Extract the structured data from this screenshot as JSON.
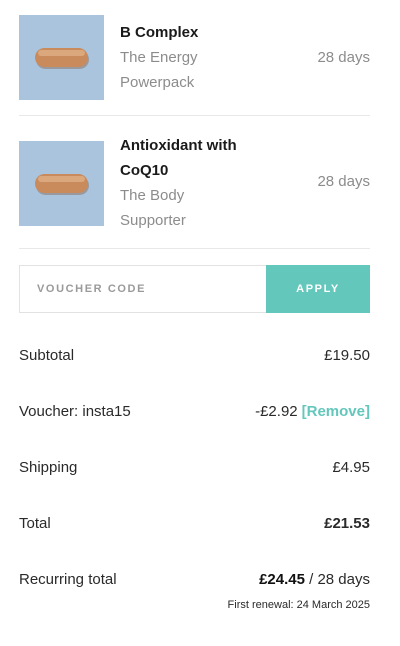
{
  "products": [
    {
      "name": "B Complex",
      "subtitle_lines": [
        "The Energy",
        "Powerpack"
      ],
      "duration": "28 days"
    },
    {
      "name_lines": [
        "Antioxidant with",
        "CoQ10"
      ],
      "subtitle_lines": [
        "The Body",
        "Supporter"
      ],
      "duration": "28 days"
    }
  ],
  "voucher": {
    "placeholder": "VOUCHER CODE",
    "value": "",
    "apply_label": "APPLY"
  },
  "summary": {
    "subtotal_label": "Subtotal",
    "subtotal_value": "£19.50",
    "voucher_label": "Voucher: insta15",
    "voucher_value": "-£2.92",
    "remove_label": "[Remove]",
    "shipping_label": "Shipping",
    "shipping_value": "£4.95",
    "total_label": "Total",
    "total_value": "£21.53",
    "recurring_label": "Recurring total",
    "recurring_value": "£24.45",
    "recurring_period": "/ 28 days",
    "renewal_note": "First renewal: 24 March 2025"
  },
  "colors": {
    "accent": "#63c7bb",
    "thumb_bg": "#a9c4dc",
    "capsule": "#c98a5c"
  }
}
